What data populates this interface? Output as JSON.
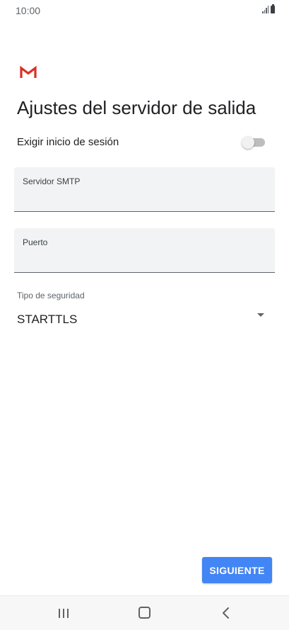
{
  "status_bar": {
    "time": "10:00",
    "signal_icon": "signal-icon",
    "battery_icon": "battery-icon"
  },
  "app": {
    "logo_icon": "gmail-logo-icon",
    "brand_color": "#d93025"
  },
  "page": {
    "title": "Ajustes del servidor de salida"
  },
  "signin": {
    "label": "Exigir inicio de sesión",
    "enabled": false
  },
  "smtp_field": {
    "label": "Servidor SMTP",
    "value": ""
  },
  "port_field": {
    "label": "Puerto",
    "value": ""
  },
  "security": {
    "label": "Tipo de seguridad",
    "selected": "STARTTLS"
  },
  "actions": {
    "next_label": "SIGUIENTE",
    "next_color": "#4285f4"
  },
  "nav_bar": {
    "recents_icon": "recents-icon",
    "home_icon": "home-icon",
    "back_icon": "back-icon"
  }
}
